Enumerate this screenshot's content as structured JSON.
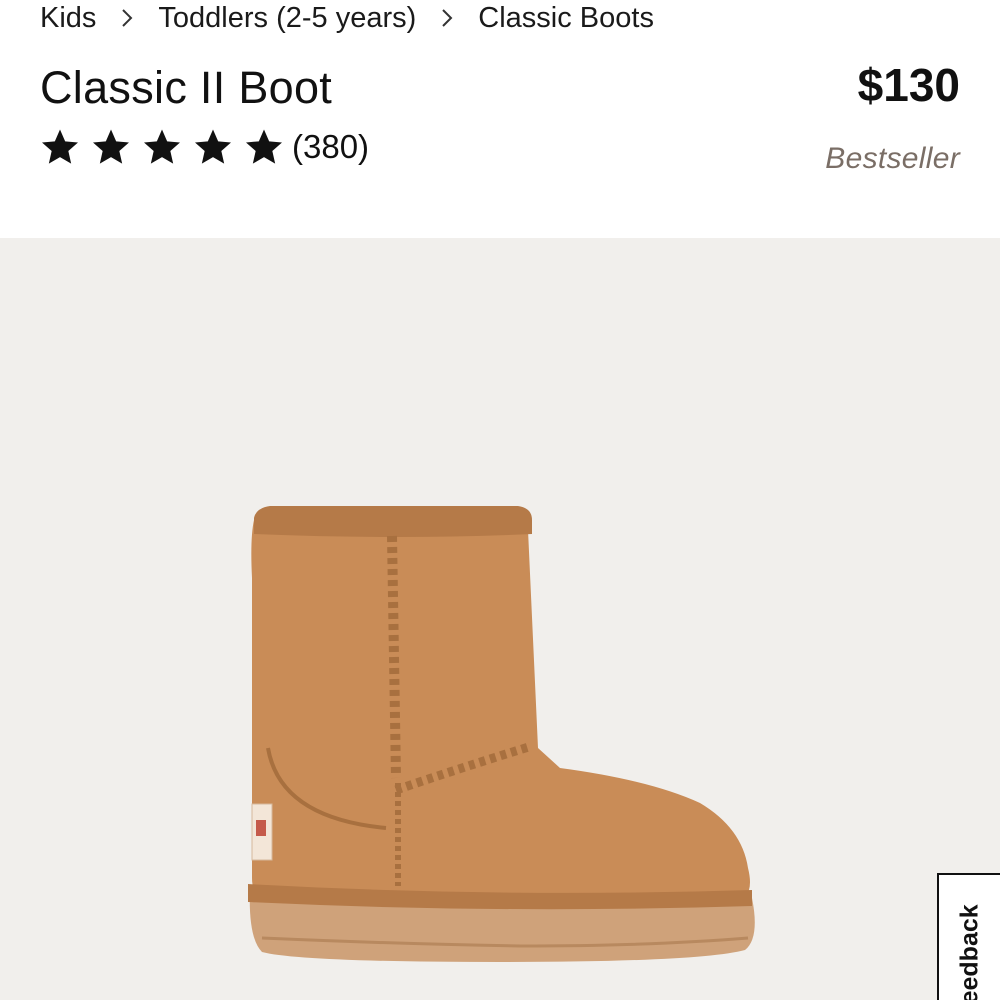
{
  "breadcrumb": [
    {
      "label": "Kids"
    },
    {
      "label": "Toddlers (2-5 years)"
    },
    {
      "label": "Classic Boots"
    }
  ],
  "product": {
    "title": "Classic II Boot",
    "price": "$130",
    "badge": "Bestseller",
    "rating": {
      "stars": 5,
      "max": 5,
      "count_label": "(380)"
    }
  },
  "gallery": {
    "image": "boot-image",
    "color_name_shown": "",
    "boot_color": "#c98c57"
  },
  "feedback": {
    "label": "Feedback"
  },
  "colors": {
    "star": "#111111",
    "badge": "#7a6e66",
    "gallery_bg": "#f1efec"
  }
}
